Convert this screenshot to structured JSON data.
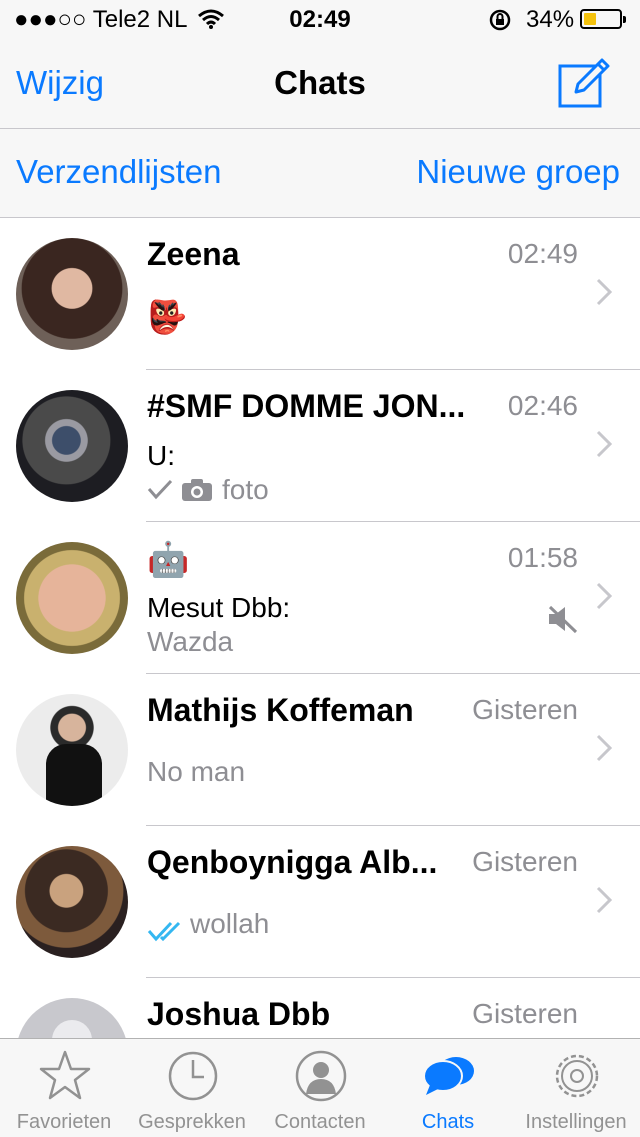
{
  "status_bar": {
    "carrier": "●●●○○ Tele2 NL",
    "time": "02:49",
    "battery_percent": "34%",
    "icons": [
      "wifi-icon",
      "rotation-lock-icon",
      "battery-icon"
    ]
  },
  "nav": {
    "edit_label": "Wijzig",
    "title": "Chats",
    "compose_icon": "compose-icon"
  },
  "subnav": {
    "broadcast_label": "Verzendlijsten",
    "new_group_label": "Nieuwe groep"
  },
  "chats": [
    {
      "name": "Zeena",
      "time": "02:49",
      "line2": "👺",
      "line3": ""
    },
    {
      "name": "#SMF DOMME JON...",
      "time": "02:46",
      "line2": "U:",
      "line3": "foto",
      "icons": [
        "checkmark-icon",
        "camera-icon"
      ]
    },
    {
      "name": "🤖",
      "time": "01:58",
      "line2": "Mesut Dbb:",
      "line3": "Wazda",
      "icons": [
        "muted-icon"
      ]
    },
    {
      "name": "Mathijs Koffeman",
      "time": "Gisteren",
      "line2": "",
      "line3": "No man"
    },
    {
      "name": "Qenboynigga Alb...",
      "time": "Gisteren",
      "line2": "",
      "line3": "wollah",
      "icons": [
        "double-check-icon"
      ]
    },
    {
      "name": "Joshua Dbb",
      "time": "Gisteren",
      "line2": "",
      "line3": ""
    }
  ],
  "tabs": [
    {
      "label": "Favorieten",
      "icon": "star-icon"
    },
    {
      "label": "Gesprekken",
      "icon": "clock-icon"
    },
    {
      "label": "Contacten",
      "icon": "person-icon"
    },
    {
      "label": "Chats",
      "icon": "chat-bubbles-icon",
      "active": true
    },
    {
      "label": "Instellingen",
      "icon": "gear-icon"
    }
  ],
  "colors": {
    "accent": "#0a7aff",
    "secondary_text": "#8e8e93",
    "bar_background": "#f7f7f7",
    "battery_fill": "#f4c20d"
  }
}
